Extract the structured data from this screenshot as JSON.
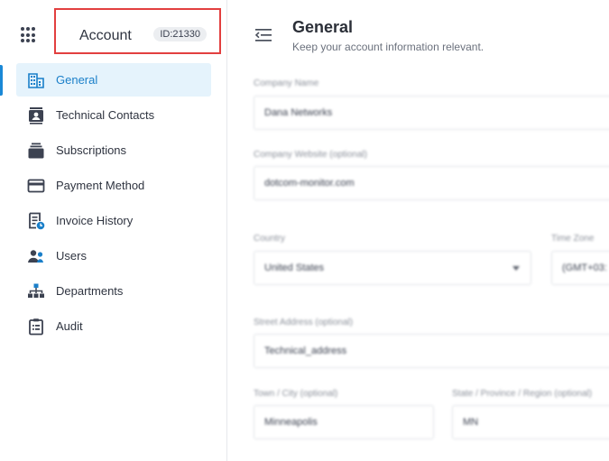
{
  "sidebar": {
    "account_title": "Account",
    "account_id": "ID:21330",
    "items": [
      {
        "label": "General",
        "icon": "building-icon",
        "active": true
      },
      {
        "label": "Technical Contacts",
        "icon": "contact-card-icon"
      },
      {
        "label": "Subscriptions",
        "icon": "subscriptions-icon"
      },
      {
        "label": "Payment Method",
        "icon": "credit-card-icon"
      },
      {
        "label": "Invoice History",
        "icon": "invoice-history-icon"
      },
      {
        "label": "Users",
        "icon": "users-icon"
      },
      {
        "label": "Departments",
        "icon": "departments-icon"
      },
      {
        "label": "Audit",
        "icon": "clipboard-icon"
      }
    ]
  },
  "header": {
    "title": "General",
    "subtitle": "Keep your account information relevant."
  },
  "form": {
    "company_name_label": "Company Name",
    "company_name_value": "Dana Networks",
    "company_website_label": "Company Website (optional)",
    "company_website_value": "dotcom-monitor.com",
    "country_label": "Country",
    "country_value": "United States",
    "timezone_label": "Time Zone",
    "timezone_value": "(GMT+03:",
    "street_label": "Street Address (optional)",
    "street_value": "Technical_address",
    "city_label": "Town / City (optional)",
    "city_value": "Minneapolis",
    "state_label": "State / Province / Region (optional)",
    "state_value": "MN"
  },
  "colors": {
    "accent": "#1a88d6",
    "active_bg": "#e5f3fc",
    "highlight_box": "#e23f3f",
    "icon": "#3c4251"
  }
}
